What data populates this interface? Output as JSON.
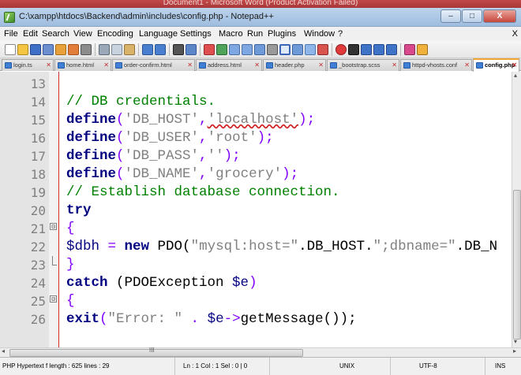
{
  "background_window": {
    "title": "Document1 - Microsoft Word (Product Activation Failed)"
  },
  "window": {
    "title": "C:\\xampp\\htdocs\\Backend\\admin\\includes\\config.php - Notepad++",
    "controls": {
      "minimize": "–",
      "maximize": "□",
      "close": "X"
    }
  },
  "menu": {
    "items": [
      "File",
      "Edit",
      "Search",
      "View",
      "Encoding",
      "Language",
      "Settings",
      "Macro",
      "Run",
      "Plugins",
      "Window",
      "?"
    ],
    "close": "X"
  },
  "tabs": [
    {
      "label": "login.ts",
      "close": "✕"
    },
    {
      "label": "home.html",
      "close": "✕"
    },
    {
      "label": "order-confirm.html",
      "close": "✕"
    },
    {
      "label": "address.html",
      "close": "✕"
    },
    {
      "label": "header.php",
      "close": "✕"
    },
    {
      "label": "_bootstrap.scss",
      "close": "✕"
    },
    {
      "label": "httpd-vhosts.conf",
      "close": "✕"
    },
    {
      "label": "config.php",
      "close": "✕",
      "active": true
    }
  ],
  "editor": {
    "lines": [
      {
        "n": "13"
      },
      {
        "n": "14",
        "t": [
          "// DB credentials."
        ]
      },
      {
        "n": "15",
        "t": [
          "define",
          "(",
          "'DB_HOST'",
          ",",
          "'localhost'",
          ");"
        ]
      },
      {
        "n": "16",
        "t": [
          "define",
          "(",
          "'DB_USER'",
          ",",
          "'root'",
          ");"
        ]
      },
      {
        "n": "17",
        "t": [
          "define",
          "(",
          "'DB_PASS'",
          ",",
          "''",
          ");"
        ]
      },
      {
        "n": "18",
        "t": [
          "define",
          "(",
          "'DB_NAME'",
          ",",
          "'grocery'",
          ");"
        ]
      },
      {
        "n": "19",
        "t": [
          "// Establish database connection."
        ]
      },
      {
        "n": "20",
        "t": [
          "try"
        ]
      },
      {
        "n": "21",
        "t": [
          "{"
        ],
        "fold": "⊟"
      },
      {
        "n": "22",
        "t": [
          "$dbh",
          " = ",
          "new",
          " PDO(",
          "\"mysql:host=\"",
          ".DB_HOST.",
          "\";dbname=\"",
          ".DB_N"
        ]
      },
      {
        "n": "23",
        "t": [
          "}"
        ]
      },
      {
        "n": "24",
        "t": [
          "catch",
          " (PDOException ",
          "$e",
          ")"
        ]
      },
      {
        "n": "25",
        "t": [
          "{"
        ],
        "fold": "⊟"
      },
      {
        "n": "26",
        "t": [
          "exit",
          "(",
          "\"Error: \"",
          " . ",
          "$e",
          "->",
          "getMessage());"
        ]
      }
    ]
  },
  "scroll": {
    "grip": "III",
    "left": "◂",
    "right": "▸",
    "up": "▴",
    "down": "▾"
  },
  "status": {
    "filetype": "PHP Hypertext f length : 625   lines : 29",
    "position": "Ln : 1   Col : 1   Sel : 0 | 0",
    "eol": "UNIX",
    "encoding": "UTF-8",
    "mode": "INS"
  },
  "colors": {
    "keyword": "#000080",
    "string": "#808080",
    "comment": "#008000",
    "operator": "#8000ff",
    "active_tab": "#f3a531"
  }
}
